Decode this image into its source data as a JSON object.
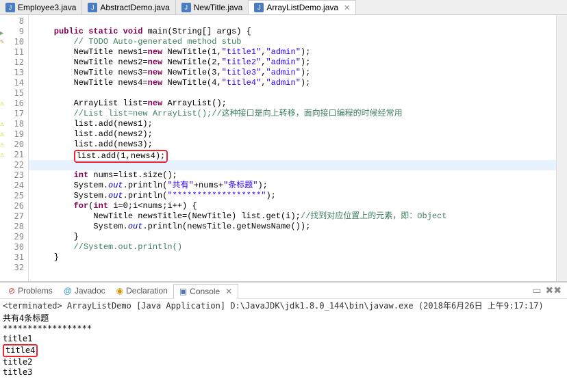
{
  "tabs": {
    "items": [
      {
        "label": "Employee3.java",
        "active": false
      },
      {
        "label": "AbstractDemo.java",
        "active": false
      },
      {
        "label": "NewTitle.java",
        "active": false
      },
      {
        "label": "ArrayListDemo.java",
        "active": true
      }
    ],
    "close_glyph": "✕"
  },
  "gutter": {
    "lines": [
      "8",
      "9",
      "10",
      "11",
      "12",
      "13",
      "14",
      "15",
      "16",
      "17",
      "18",
      "19",
      "20",
      "21",
      "22",
      "23",
      "24",
      "25",
      "26",
      "27",
      "28",
      "29",
      "30",
      "31",
      "32"
    ]
  },
  "code": {
    "l8": "",
    "l9a": "    public static void",
    "l9b": " main(String[] args) {",
    "l10a": "        ",
    "l10b": "// TODO Auto-generated method stub",
    "l11a": "        NewTitle news1=",
    "l11b": "new",
    "l11c": " NewTitle(1,",
    "l11d": "\"title1\"",
    "l11e": ",",
    "l11f": "\"admin\"",
    "l11g": ");",
    "l12a": "        NewTitle news2=",
    "l12b": "new",
    "l12c": " NewTitle(2,",
    "l12d": "\"title2\"",
    "l12e": ",",
    "l12f": "\"admin\"",
    "l12g": ");",
    "l13a": "        NewTitle news3=",
    "l13b": "new",
    "l13c": " NewTitle(3,",
    "l13d": "\"title3\"",
    "l13e": ",",
    "l13f": "\"admin\"",
    "l13g": ");",
    "l14a": "        NewTitle news4=",
    "l14b": "new",
    "l14c": " NewTitle(4,",
    "l14d": "\"title4\"",
    "l14e": ",",
    "l14f": "\"admin\"",
    "l14g": ");",
    "l15": "",
    "l16a": "        ArrayList list=",
    "l16b": "new",
    "l16c": " ArrayList();",
    "l17a": "        ",
    "l17b": "//List list=new ArrayList();//这种接口是向上转移，面向接口编程的时候经常用",
    "l18a": "        list.add(news1);",
    "l19a": "        list.add(news2);",
    "l20a": "        list.add(news3);",
    "l21a": "        ",
    "l21b": "list.add(1,news4);",
    "l22": "",
    "l23a": "        ",
    "l23b": "int",
    "l23c": " nums=list.size();",
    "l24a": "        System.",
    "l24b": "out",
    "l24c": ".println(",
    "l24d": "\"共有\"",
    "l24e": "+nums+",
    "l24f": "\"条标题\"",
    "l24g": ");",
    "l25a": "        System.",
    "l25b": "out",
    "l25c": ".println(",
    "l25d": "\"******************\"",
    "l25e": ");",
    "l26a": "        ",
    "l26b": "for",
    "l26c": "(",
    "l26d": "int",
    "l26e": " i=0;i<nums;i++) {",
    "l27a": "            NewTitle newsTitle=(NewTitle) list.get(i);",
    "l27b": "//找到对应位置上的元素，即：Object",
    "l28a": "            System.",
    "l28b": "out",
    "l28c": ".println(newsTitle.getNewsName());",
    "l29a": "        }",
    "l30a": "        ",
    "l30b": "//System.out.println()",
    "l31a": "    }",
    "l32": ""
  },
  "panel": {
    "tabs": {
      "problems": "Problems",
      "javadoc": "Javadoc",
      "declaration": "Declaration",
      "console": "Console"
    },
    "close_glyph": "✕"
  },
  "console": {
    "terminated": "<terminated> ArrayListDemo [Java Application] D:\\JavaJDK\\jdk1.8.0_144\\bin\\javaw.exe (2018年6月26日 上午9:17:17)",
    "out1": "共有4条标题",
    "out2": "******************",
    "out3": "title1",
    "out4": "title4",
    "out5": "title2",
    "out6": "title3"
  }
}
